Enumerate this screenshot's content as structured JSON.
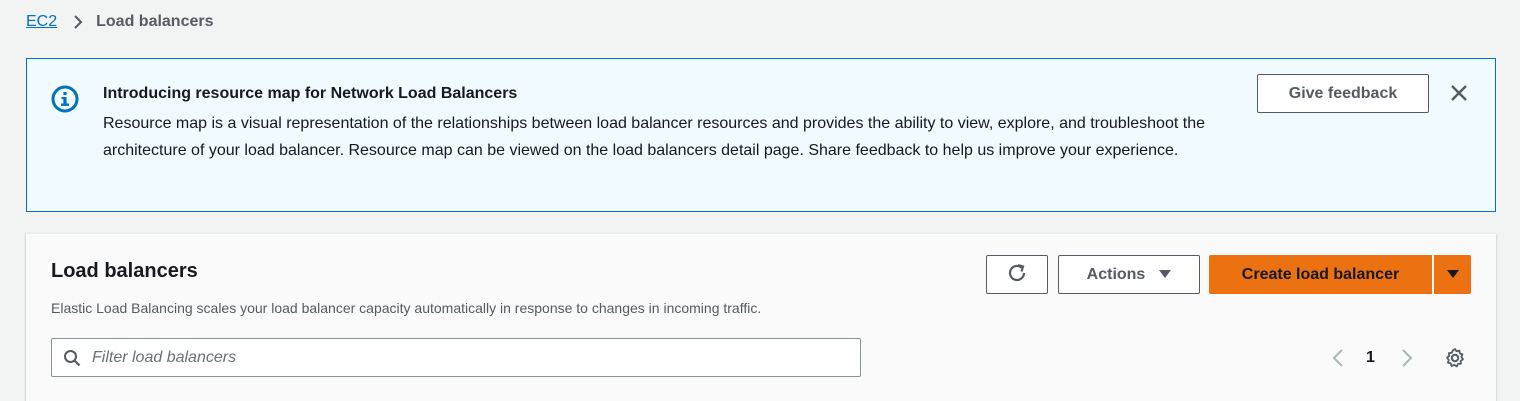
{
  "breadcrumb": {
    "root": "EC2",
    "current": "Load balancers"
  },
  "flash": {
    "title": "Introducing resource map for Network Load Balancers",
    "body": "Resource map is a visual representation of the relationships between load balancer resources and provides the ability to view, explore, and troubleshoot the architecture of your load balancer. Resource map can be viewed on the load balancers detail page. Share feedback to help us improve your experience.",
    "feedback_label": "Give feedback",
    "icon": "info-icon"
  },
  "panel": {
    "heading": "Load balancers",
    "description": "Elastic Load Balancing scales your load balancer capacity automatically in response to changes in incoming traffic.",
    "actions_label": "Actions",
    "create_label": "Create load balancer",
    "search_placeholder": "Filter load balancers",
    "search_value": "",
    "page_number": "1"
  },
  "colors": {
    "link": "#0073bb",
    "primary": "#ec7211",
    "info_bg": "#f1faff",
    "info_border": "#0073bb"
  }
}
